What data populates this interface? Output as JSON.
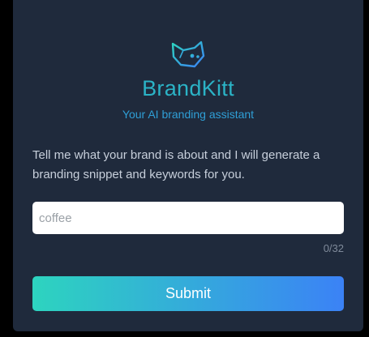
{
  "brand": {
    "title": "BrandKitt",
    "subtitle": "Your AI branding assistant",
    "logo_icon": "cat-head-icon",
    "title_color": "#2bb3c6",
    "subtitle_color": "#2f9fd6"
  },
  "prompt": {
    "description": "Tell me what your brand is about and I will generate a branding snippet and keywords for you."
  },
  "input": {
    "value": "",
    "placeholder": "coffee",
    "counter": "0/32"
  },
  "submit": {
    "label": "Submit",
    "gradient_start": "#2dd4bf",
    "gradient_end": "#3b82f6"
  },
  "theme": {
    "card_background": "#1f2a3c",
    "page_background": "#000000"
  }
}
